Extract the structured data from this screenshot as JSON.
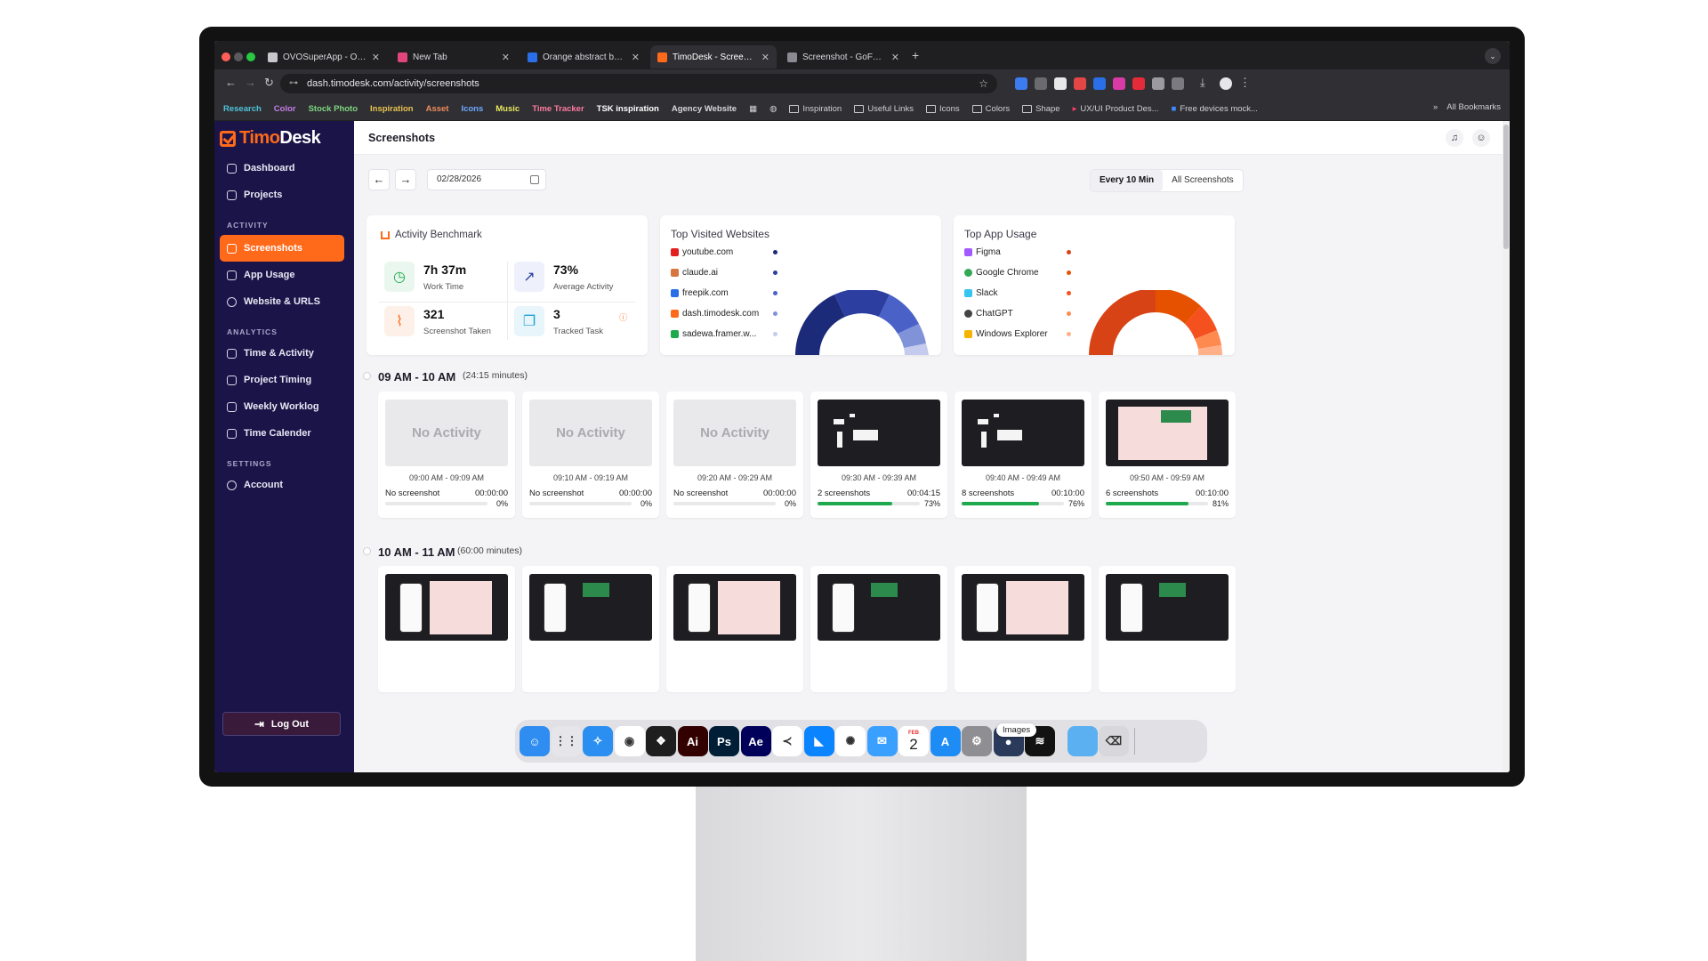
{
  "browser": {
    "tabs": [
      {
        "label": "OVOSuperApp - OvoSuper D...",
        "color": "#c8c8cc"
      },
      {
        "label": "New Tab",
        "color": "#e0457b"
      },
      {
        "label": "Orange abstract background...",
        "color": "#2a6fe8"
      },
      {
        "label": "TimoDesk - Screenshots",
        "color": "#ff6a1a"
      },
      {
        "label": "Screenshot - GoFullPage",
        "color": "#8a8a90"
      }
    ],
    "url": "dash.timodesk.com/activity/screenshots",
    "bookmarks": [
      {
        "label": "Research",
        "color": "#4fc3d9"
      },
      {
        "label": "Color",
        "color": "#c67ee8"
      },
      {
        "label": "Stock Photo",
        "color": "#7fd67f"
      },
      {
        "label": "Inspiration",
        "color": "#e8c24f"
      },
      {
        "label": "Asset",
        "color": "#f08a5d"
      },
      {
        "label": "Icons",
        "color": "#6fa8ff"
      },
      {
        "label": "Music",
        "color": "#e8e85f"
      },
      {
        "label": "Time Tracker",
        "color": "#ff7aa0"
      },
      {
        "label": "TSK inspiration",
        "color": "#ffffff"
      },
      {
        "label": "Agency Website",
        "color": "#d8d8dc"
      }
    ],
    "folders": [
      "Inspiration",
      "Useful Links",
      "Icons",
      "Colors",
      "Shape",
      "UX/UI Product Des...",
      "Free devices mock..."
    ],
    "all_bookmarks": "All Bookmarks"
  },
  "sidebar": {
    "logo_a": "Timo",
    "logo_b": "Desk",
    "items_top": [
      {
        "label": "Dashboard",
        "icon": "dashboard-icon"
      },
      {
        "label": "Projects",
        "icon": "projects-icon"
      }
    ],
    "section_activity": "ACTIVITY",
    "items_activity": [
      {
        "label": "Screenshots",
        "icon": "screenshots-icon"
      },
      {
        "label": "App Usage",
        "icon": "app-usage-icon"
      },
      {
        "label": "Website & URLS",
        "icon": "globe-icon"
      }
    ],
    "section_analytics": "ANALYTICS",
    "items_analytics": [
      {
        "label": "Time & Activity",
        "icon": "calendar-icon"
      },
      {
        "label": "Project Timing",
        "icon": "hourglass-icon"
      },
      {
        "label": "Weekly Worklog",
        "icon": "worklog-icon"
      },
      {
        "label": "Time Calender",
        "icon": "time-calendar-icon"
      }
    ],
    "section_settings": "SETTINGS",
    "items_settings": [
      {
        "label": "Account",
        "icon": "gear-icon"
      }
    ],
    "logout": "Log Out"
  },
  "header": {
    "title": "Screenshots"
  },
  "filters": {
    "prev": "←",
    "next": "→",
    "date": "02/28/2026",
    "mode_selected": "Every 10 Min",
    "mode_other": "All Screenshots"
  },
  "benchmark": {
    "title": "Activity Benchmark",
    "work_time": "7h 37m",
    "work_time_label": "Work Time",
    "avg_activity": "73%",
    "avg_activity_label": "Average Activity",
    "screens": "321",
    "screens_label": "Screenshot Taken",
    "tasks": "3",
    "tasks_label": "Tracked Task"
  },
  "websites": {
    "title": "Top Visited Websites",
    "items": [
      {
        "label": "youtube.com",
        "color": "#1c2a7a",
        "fav": "#e32020"
      },
      {
        "label": "claude.ai",
        "color": "#2c3ea0",
        "fav": "#d8743f"
      },
      {
        "label": "freepik.com",
        "color": "#4a62c8",
        "fav": "#2a6fe8"
      },
      {
        "label": "dash.timodesk.com",
        "color": "#8092d8",
        "fav": "#ff6a1a"
      },
      {
        "label": "sadewa.framer.w...",
        "color": "#c4cbee",
        "fav": "#1eaa4c"
      }
    ]
  },
  "apps": {
    "title": "Top App Usage",
    "items": [
      {
        "label": "Figma",
        "color": "#d84315",
        "fav": "#a259ff"
      },
      {
        "label": "Google Chrome",
        "color": "#e65100",
        "fav": "#34a853"
      },
      {
        "label": "Slack",
        "color": "#f4511e",
        "fav": "#36c5f0"
      },
      {
        "label": "ChatGPT",
        "color": "#ff8a50",
        "fav": "#444444"
      },
      {
        "label": "Windows Explorer",
        "color": "#ffb088",
        "fav": "#f4b400"
      }
    ]
  },
  "hours": [
    {
      "title": "09 AM - 10 AM",
      "sub": "(24:15 minutes)",
      "shots": [
        {
          "thumb": "No Activity",
          "range": "09:00 AM - 09:09 AM",
          "count": "No screenshot",
          "dur": "00:00:00",
          "pct": "0%",
          "level": 0
        },
        {
          "thumb": "No Activity",
          "range": "09:10 AM - 09:19 AM",
          "count": "No screenshot",
          "dur": "00:00:00",
          "pct": "0%",
          "level": 0
        },
        {
          "thumb": "No Activity",
          "range": "09:20 AM - 09:29 AM",
          "count": "No screenshot",
          "dur": "00:00:00",
          "pct": "0%",
          "level": 0
        },
        {
          "thumb": "",
          "range": "09:30 AM - 09:39 AM",
          "count": "2 screenshots",
          "dur": "00:04:15",
          "pct": "73%",
          "level": 0.73
        },
        {
          "thumb": "",
          "range": "09:40 AM - 09:49 AM",
          "count": "8 screenshots",
          "dur": "00:10:00",
          "pct": "76%",
          "level": 0.76
        },
        {
          "thumb": "",
          "range": "09:50 AM - 09:59 AM",
          "count": "6 screenshots",
          "dur": "00:10:00",
          "pct": "81%",
          "level": 0.81
        }
      ]
    },
    {
      "title": "10 AM - 11 AM",
      "sub": "(60:00 minutes)"
    }
  ],
  "dock": {
    "tooltip": "Images",
    "calendar_month": "FEB",
    "calendar_day": "2",
    "apps": [
      {
        "name": "finder-icon",
        "color": "#2f8cf0",
        "glyph": "☺"
      },
      {
        "name": "launchpad-icon",
        "color": "#e6e6ea",
        "glyph": "⋮⋮"
      },
      {
        "name": "safari-icon",
        "color": "#2a8ff0",
        "glyph": "✧"
      },
      {
        "name": "chrome-icon",
        "color": "#ffffff",
        "glyph": "◉"
      },
      {
        "name": "figma-icon",
        "color": "#1e1e1e",
        "glyph": "❖"
      },
      {
        "name": "illustrator-icon",
        "color": "#330000",
        "glyph": "Ai"
      },
      {
        "name": "photoshop-icon",
        "color": "#001e36",
        "glyph": "Ps"
      },
      {
        "name": "after-effects-icon",
        "color": "#00005b",
        "glyph": "Ae"
      },
      {
        "name": "vscode-icon",
        "color": "#ffffff",
        "glyph": "≺"
      },
      {
        "name": "framer-icon",
        "color": "#0a84ff",
        "glyph": "◣"
      },
      {
        "name": "chatgpt-icon",
        "color": "#ffffff",
        "glyph": "✺"
      },
      {
        "name": "mail-icon",
        "color": "#3aa0ff",
        "glyph": "✉"
      },
      {
        "name": "calendar-icon",
        "color": "#ffffff",
        "glyph": ""
      },
      {
        "name": "app-store-icon",
        "color": "#1e8cf5",
        "glyph": "A"
      },
      {
        "name": "system-settings-icon",
        "color": "#8e8e93",
        "glyph": "⚙"
      },
      {
        "name": "browser-icon",
        "color": "#2a3a5a",
        "glyph": "●"
      },
      {
        "name": "spotify-icon",
        "color": "#121212",
        "glyph": "≋"
      },
      {
        "name": "folder-icon",
        "color": "#5ab0f0",
        "glyph": ""
      },
      {
        "name": "trash-icon",
        "color": "#d8d8dc",
        "glyph": "⌫"
      }
    ]
  }
}
